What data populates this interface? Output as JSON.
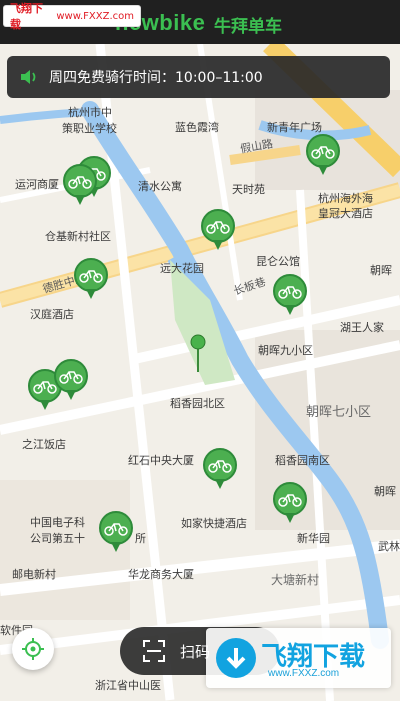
{
  "watermark_top": {
    "text_cn": "飞翔下载",
    "text_url": "www.FXXZ.com"
  },
  "app": {
    "logo_text": "newbike",
    "brand_cn": "牛拜单车"
  },
  "notice": {
    "text": "周四免费骑行时间：10:00–11:00"
  },
  "map": {
    "roads": [
      "假山路",
      "德胜中路",
      "长板巷"
    ],
    "places": [
      "杭州市中",
      "策职业学校",
      "运河商厦",
      "仓基新村社区",
      "汉庭酒店",
      "之江饭店",
      "蓝色霞湾",
      "清水公寓",
      "天时苑",
      "远大花园",
      "新青年广场",
      "杭州海外海",
      "皇冠大酒店",
      "昆仑公馆",
      "朝晖九小区",
      "湖王人家",
      "朝晖七小区",
      "朝晖",
      "稻香园北区",
      "红石中央大厦",
      "稻香园南区",
      "如家快捷酒店",
      "新华园",
      "中国电子科",
      "公司第五十",
      "所",
      "邮电新村",
      "华龙商务大厦",
      "大塘新村",
      "武林",
      "软件园",
      "浙江省中山医",
      "朝晖"
    ]
  },
  "controls": {
    "scan_label": "扫码"
  },
  "watermark_bottom": {
    "big": "飞翔下载",
    "small": "www.FXXZ.com"
  },
  "colors": {
    "accent": "#3bbf51",
    "pin": "#4caf50",
    "topbar": "#202020"
  }
}
